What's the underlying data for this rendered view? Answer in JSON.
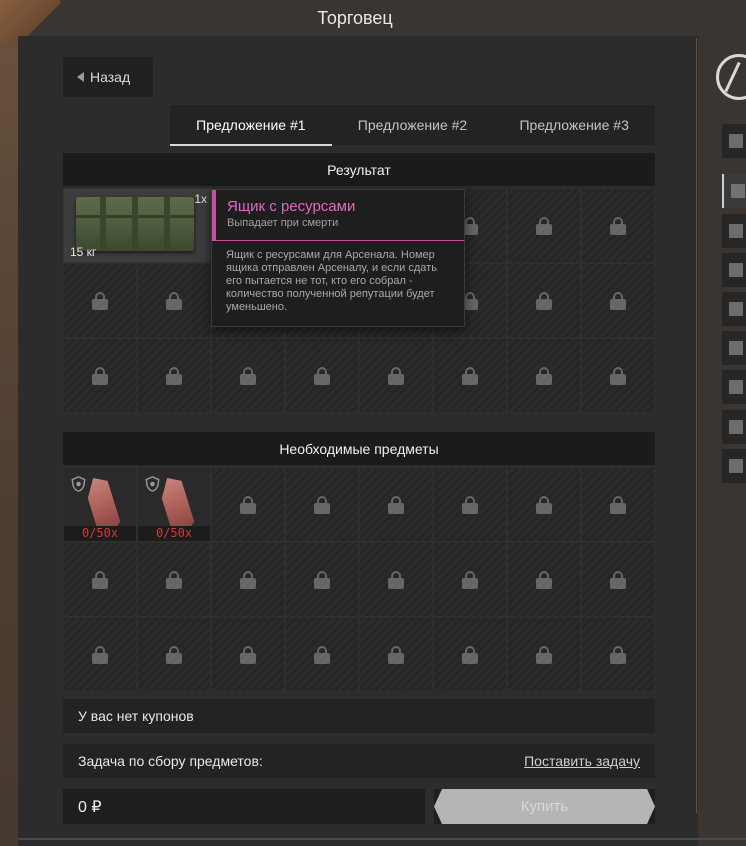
{
  "window": {
    "title": "Торговец"
  },
  "nav": {
    "back_label": "Назад"
  },
  "tabs": [
    {
      "label": "Предложение #1",
      "active": true
    },
    {
      "label": "Предложение #2",
      "active": false
    },
    {
      "label": "Предложение #3",
      "active": false
    }
  ],
  "result": {
    "header": "Результат",
    "item": {
      "quantity": "1x",
      "weight": "15 кг",
      "icon": "resource-crate-icon"
    }
  },
  "tooltip": {
    "name": "Ящик с ресурсами",
    "subtitle": "Выпадает при смерти",
    "description": "Ящик с ресурсами для Арсенала. Номер ящика отправлен Арсеналу, и если сдать его пытается не тот, кто его собрал - количество полученной репутации будет уменьшено.",
    "accent_color": "#c64fa0"
  },
  "required": {
    "header": "Необходимые предметы",
    "items": [
      {
        "count": "0/50x",
        "icon": "shard-icon"
      },
      {
        "count": "0/50x",
        "icon": "shard-icon"
      }
    ]
  },
  "coupons": {
    "text": "У вас нет купонов"
  },
  "task": {
    "label": "Задача по сбору предметов:",
    "link": "Поставить задачу"
  },
  "price": {
    "value": "0 ₽"
  },
  "buy": {
    "label": "Купить"
  },
  "colors": {
    "count_missing": "#d33a3a",
    "rarity": "#c64fa0"
  }
}
